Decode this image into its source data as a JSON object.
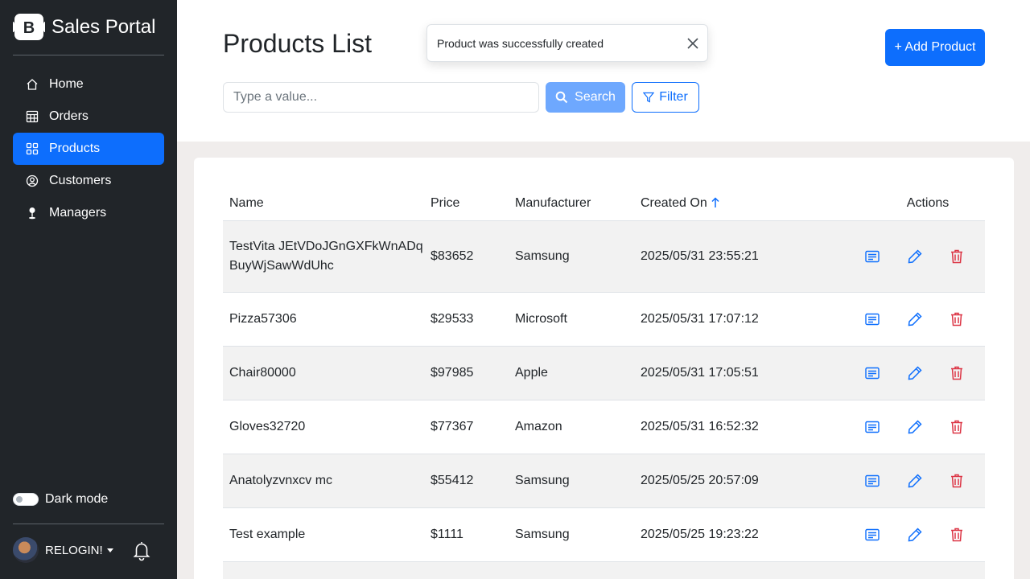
{
  "app": {
    "title": "Sales Portal"
  },
  "sidebar": {
    "items": [
      {
        "label": "Home",
        "icon": "house-icon"
      },
      {
        "label": "Orders",
        "icon": "table-icon"
      },
      {
        "label": "Products",
        "icon": "grid-icon",
        "active": true
      },
      {
        "label": "Customers",
        "icon": "person-circle-icon"
      },
      {
        "label": "Managers",
        "icon": "person-pin-icon"
      }
    ],
    "dark_mode_label": "Dark mode",
    "user_name": "RELOGIN!"
  },
  "header": {
    "title": "Products List",
    "add_button": "+ Add Product",
    "search_placeholder": "Type a value...",
    "search_button": "Search",
    "filter_button": "Filter"
  },
  "toast": {
    "message": "Product was successfully created"
  },
  "table": {
    "columns": [
      "Name",
      "Price",
      "Manufacturer",
      "Created On",
      "Actions"
    ],
    "sorted_column": "Created On",
    "sort_direction": "ascending",
    "rows": [
      {
        "name": "TestVita JEtVDoJGnGXFkWnADqBuyWjSawWdUhc",
        "price": "$83652",
        "manufacturer": "Samsung",
        "created": "2025/05/31 23:55:21"
      },
      {
        "name": "Pizza57306",
        "price": "$29533",
        "manufacturer": "Microsoft",
        "created": "2025/05/31 17:07:12"
      },
      {
        "name": "Chair80000",
        "price": "$97985",
        "manufacturer": "Apple",
        "created": "2025/05/31 17:05:51"
      },
      {
        "name": "Gloves32720",
        "price": "$77367",
        "manufacturer": "Amazon",
        "created": "2025/05/31 16:52:32"
      },
      {
        "name": "Anatolyzvnxcv mc",
        "price": "$55412",
        "manufacturer": "Samsung",
        "created": "2025/05/25 20:57:09"
      },
      {
        "name": "Test example",
        "price": "$1111",
        "manufacturer": "Samsung",
        "created": "2025/05/25 19:23:22"
      }
    ]
  },
  "colors": {
    "primary": "#0d6efd",
    "sidebar_bg": "#212529",
    "danger": "#dc3545",
    "search_disabled": "#6ea8fe"
  }
}
